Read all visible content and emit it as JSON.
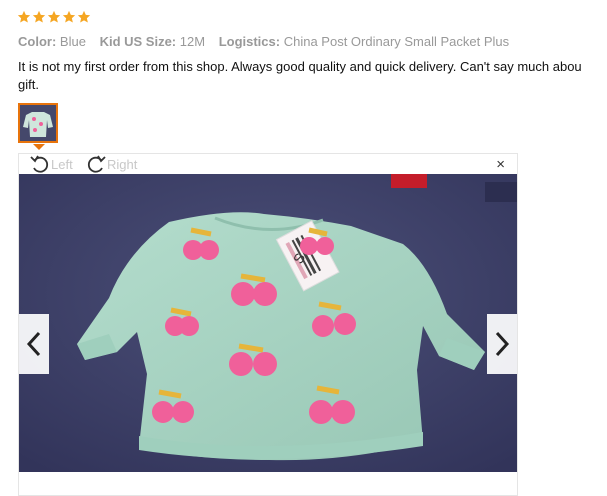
{
  "review": {
    "rating": 5,
    "star_color": "#f5a623",
    "attributes": [
      {
        "key": "Color:",
        "value": "Blue"
      },
      {
        "key": "Kid US Size:",
        "value": "12M"
      },
      {
        "key": "Logistics:",
        "value": "China Post Ordinary Small Packet Plus"
      }
    ],
    "text_line1": "It is not my first order from this shop. Always good quality and quick delivery. Can't say much abou",
    "text_line2": "gift."
  },
  "viewer": {
    "rotate_left_label": "Left",
    "rotate_right_label": "Right",
    "close_glyph": "×",
    "photo_tag_text": "S"
  },
  "colors": {
    "accent": "#e8740c",
    "sweater": "#a9d6c4",
    "carpet": "#3f4268",
    "cherry": "#f0609a",
    "leaf": "#e6b53a"
  }
}
